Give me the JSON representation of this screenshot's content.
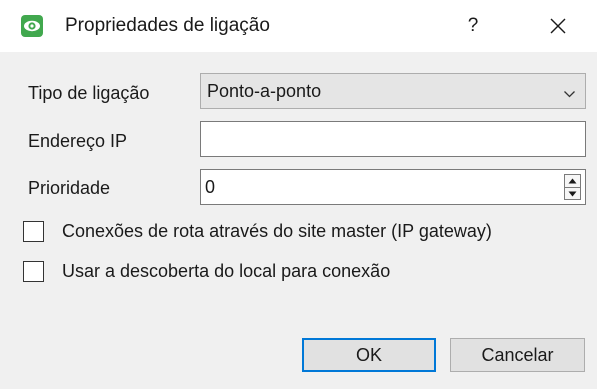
{
  "window": {
    "title": "Propriedades de ligação",
    "help_label": "?",
    "icon": "eye-icon",
    "accent_color": "#41a84e"
  },
  "form": {
    "connection_type": {
      "label": "Tipo de ligação",
      "value": "Ponto-a-ponto"
    },
    "ip_address": {
      "label": "Endereço IP",
      "value": ""
    },
    "priority": {
      "label": "Prioridade",
      "value": "0"
    }
  },
  "options": [
    {
      "label": "Conexões de rota através do site master (IP gateway)",
      "checked": false
    },
    {
      "label": "Usar a descoberta do local para conexão",
      "checked": false
    }
  ],
  "buttons": {
    "ok_label": "OK",
    "cancel_label": "Cancelar",
    "default_border_color": "#0078d7"
  }
}
